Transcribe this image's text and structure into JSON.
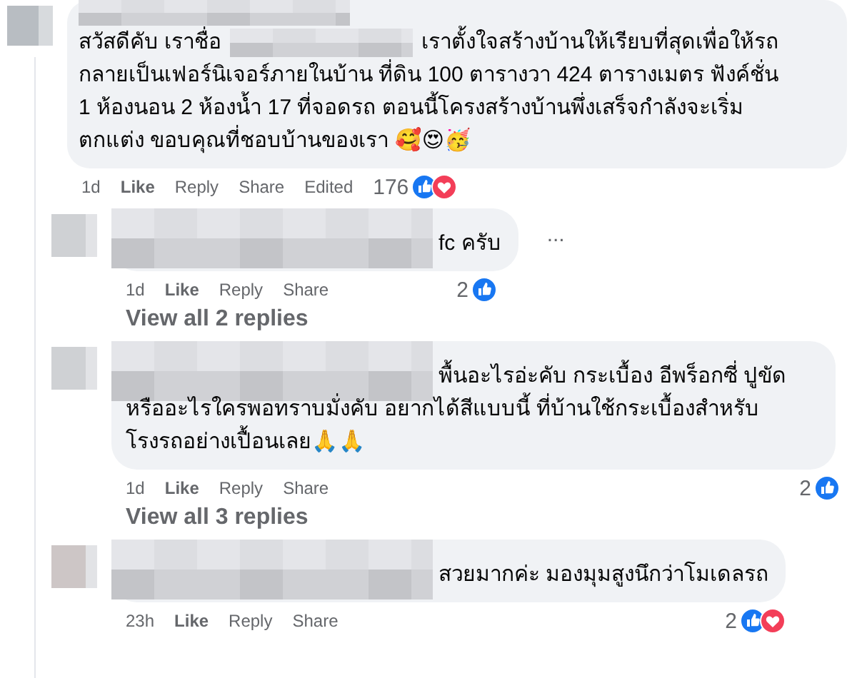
{
  "comments": [
    {
      "kind": "top",
      "greeting": "สวัสดีคับ เราชื่อ",
      "lines": [
        "เราตั้งใจสร้างบ้านให้เรียบที่สุดเพื่อให้รถ",
        "กลายเป็นเฟอร์นิเจอร์ภายในบ้าน ที่ดิน 100 ตารางวา 424 ตารางเมตร ฟังค์ชั่น",
        "1 ห้องนอน 2 ห้องน้ำ 17 ที่จอดรถ ตอนนี้โครงสร้างบ้านพึ่งเสร็จกำลังจะเริ่ม",
        "ตกแต่ง ขอบคุณที่ชอบบ้านของเรา 🥰😍🥳"
      ],
      "time": "1d",
      "actions": [
        "Like",
        "Reply",
        "Share"
      ],
      "edited": "Edited",
      "reaction_count": "176",
      "reactions": [
        {
          "kind": "like"
        },
        {
          "kind": "love"
        }
      ]
    },
    {
      "kind": "reply",
      "lines": [
        "fc ครับ"
      ],
      "more": "...",
      "time": "1d",
      "actions": [
        "Like",
        "Reply",
        "Share"
      ],
      "reaction_count": "2",
      "reactions": [
        {
          "kind": "like"
        }
      ],
      "replies_link": "View all 2 replies"
    },
    {
      "kind": "reply",
      "lines": [
        "พื้นอะไรอ่ะคับ กระเบื้อง อีพร็อกซี่ ปูขัด",
        "หรืออะไรใครพอทราบมั่งคับ อยากได้สีแบบนี้ ที่บ้านใช้กระเบื้องสำหรับ",
        "โรงรถอย่างเปื้อนเลย🙏🙏"
      ],
      "time": "1d",
      "actions": [
        "Like",
        "Reply",
        "Share"
      ],
      "reaction_count": "2",
      "reactions": [
        {
          "kind": "like"
        }
      ],
      "replies_link": "View all 3 replies"
    },
    {
      "kind": "reply",
      "lines": [
        "สวยมากค่ะ มองมุมสูงนึกว่าโมเดลรถ"
      ],
      "time": "23h",
      "actions": [
        "Like",
        "Reply",
        "Share"
      ],
      "reaction_count": "2",
      "reactions": [
        {
          "kind": "like"
        },
        {
          "kind": "love"
        }
      ]
    }
  ]
}
